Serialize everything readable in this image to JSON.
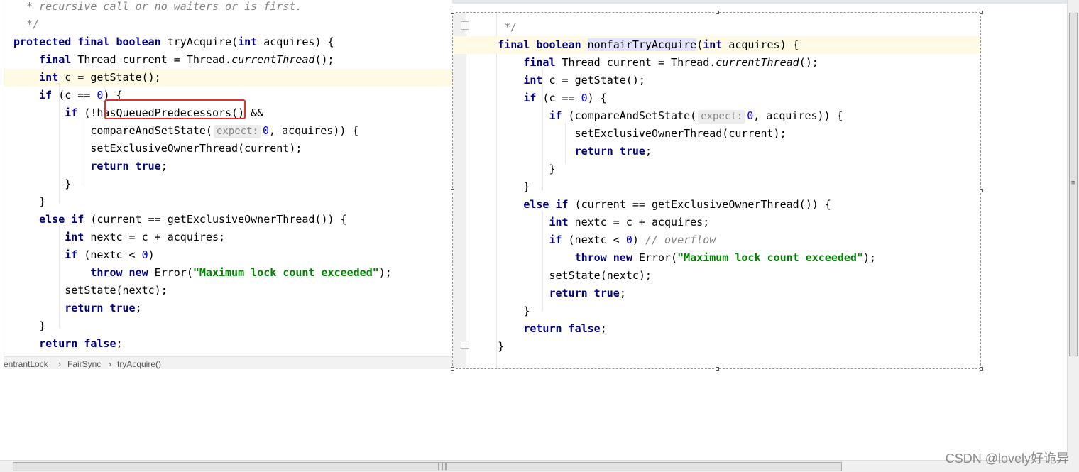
{
  "left_editor": {
    "lines": [
      [
        {
          "t": "  * recursive call or no waiters or is first.",
          "c": "cm"
        }
      ],
      [
        {
          "t": "  */",
          "c": "cm"
        }
      ],
      [
        {
          "t": "protected final boolean",
          "c": "kw"
        },
        {
          "t": " tryAcquire("
        },
        {
          "t": "int",
          "c": "kw"
        },
        {
          "t": " acquires) {"
        }
      ],
      [
        {
          "t": "    "
        },
        {
          "t": "final",
          "c": "kw"
        },
        {
          "t": " Thread current = Thread."
        },
        {
          "t": "currentThread",
          "c": "ita"
        },
        {
          "t": "();"
        }
      ],
      [
        {
          "t": "    "
        },
        {
          "t": "int",
          "c": "kw"
        },
        {
          "t": " c = getState();"
        }
      ],
      [
        {
          "t": "    "
        },
        {
          "t": "if",
          "c": "kw"
        },
        {
          "t": " (c == "
        },
        {
          "t": "0",
          "c": "num"
        },
        {
          "t": ") {"
        }
      ],
      [
        {
          "t": "        "
        },
        {
          "t": "if",
          "c": "kw"
        },
        {
          "t": " (!hasQueuedPredecessors() &&"
        }
      ],
      [
        {
          "t": "            compareAndSetState("
        },
        {
          "t": "expect:",
          "c": "hint"
        },
        {
          "t": "0",
          "c": "num"
        },
        {
          "t": ", acquires)) {"
        }
      ],
      [
        {
          "t": "            setExclusiveOwnerThread(current);"
        }
      ],
      [
        {
          "t": "            "
        },
        {
          "t": "return true",
          "c": "kw"
        },
        {
          "t": ";"
        }
      ],
      [
        {
          "t": "        }"
        }
      ],
      [
        {
          "t": "    }"
        }
      ],
      [
        {
          "t": "    "
        },
        {
          "t": "else if",
          "c": "kw"
        },
        {
          "t": " (current == getExclusiveOwnerThread()) {"
        }
      ],
      [
        {
          "t": "        "
        },
        {
          "t": "int",
          "c": "kw"
        },
        {
          "t": " nextc = c + acquires;"
        }
      ],
      [
        {
          "t": "        "
        },
        {
          "t": "if",
          "c": "kw"
        },
        {
          "t": " (nextc < "
        },
        {
          "t": "0",
          "c": "num"
        },
        {
          "t": ")"
        }
      ],
      [
        {
          "t": "            "
        },
        {
          "t": "throw new",
          "c": "kw"
        },
        {
          "t": " Error("
        },
        {
          "t": "\"Maximum lock count exceeded\"",
          "c": "str"
        },
        {
          "t": ");"
        }
      ],
      [
        {
          "t": "        setState(nextc);"
        }
      ],
      [
        {
          "t": "        "
        },
        {
          "t": "return true",
          "c": "kw"
        },
        {
          "t": ";"
        }
      ],
      [
        {
          "t": "    }"
        }
      ],
      [
        {
          "t": "    "
        },
        {
          "t": "return false",
          "c": "kw"
        },
        {
          "t": ";"
        }
      ]
    ],
    "highlighted_line": 4
  },
  "right_editor": {
    "lines": [
      [
        {
          "t": "        */",
          "c": "cm"
        }
      ],
      [
        {
          "t": "       "
        },
        {
          "t": "final boolean",
          "c": "kw"
        },
        {
          "t": " "
        },
        {
          "t": "nonfairTryAcquire",
          "c": "mark"
        },
        {
          "t": "("
        },
        {
          "t": "int",
          "c": "kw"
        },
        {
          "t": " acquires) {"
        }
      ],
      [
        {
          "t": "           "
        },
        {
          "t": "final",
          "c": "kw"
        },
        {
          "t": " Thread current = Thread."
        },
        {
          "t": "currentThread",
          "c": "ita"
        },
        {
          "t": "();"
        }
      ],
      [
        {
          "t": "           "
        },
        {
          "t": "int",
          "c": "kw"
        },
        {
          "t": " c = getState();"
        }
      ],
      [
        {
          "t": "           "
        },
        {
          "t": "if",
          "c": "kw"
        },
        {
          "t": " (c == "
        },
        {
          "t": "0",
          "c": "num"
        },
        {
          "t": ") {"
        }
      ],
      [
        {
          "t": "               "
        },
        {
          "t": "if",
          "c": "kw"
        },
        {
          "t": " (compareAndSetState("
        },
        {
          "t": "expect:",
          "c": "hint"
        },
        {
          "t": "0",
          "c": "num"
        },
        {
          "t": ", acquires)) {"
        }
      ],
      [
        {
          "t": "                   setExclusiveOwnerThread(current);"
        }
      ],
      [
        {
          "t": "                   "
        },
        {
          "t": "return true",
          "c": "kw"
        },
        {
          "t": ";"
        }
      ],
      [
        {
          "t": "               }"
        }
      ],
      [
        {
          "t": "           }"
        }
      ],
      [
        {
          "t": "           "
        },
        {
          "t": "else if",
          "c": "kw"
        },
        {
          "t": " (current == getExclusiveOwnerThread()) {"
        }
      ],
      [
        {
          "t": "               "
        },
        {
          "t": "int",
          "c": "kw"
        },
        {
          "t": " nextc = c + acquires;"
        }
      ],
      [
        {
          "t": "               "
        },
        {
          "t": "if",
          "c": "kw"
        },
        {
          "t": " (nextc < "
        },
        {
          "t": "0",
          "c": "num"
        },
        {
          "t": ") "
        },
        {
          "t": "// overflow",
          "c": "cm"
        }
      ],
      [
        {
          "t": "                   "
        },
        {
          "t": "throw new",
          "c": "kw"
        },
        {
          "t": " Error("
        },
        {
          "t": "\"Maximum lock count exceeded\"",
          "c": "str"
        },
        {
          "t": ");"
        }
      ],
      [
        {
          "t": "               setState(nextc);"
        }
      ],
      [
        {
          "t": "               "
        },
        {
          "t": "return true",
          "c": "kw"
        },
        {
          "t": ";"
        }
      ],
      [
        {
          "t": "           }"
        }
      ],
      [
        {
          "t": "           "
        },
        {
          "t": "return false",
          "c": "kw"
        },
        {
          "t": ";"
        }
      ],
      [
        {
          "t": "       }"
        }
      ]
    ],
    "highlighted_line": 1
  },
  "breadcrumb": {
    "items": [
      "entrantLock",
      "FairSync",
      "tryAcquire()"
    ],
    "separator": "›"
  },
  "scrollbar_grip": "|||",
  "watermark": "CSDN @lovely好诡异",
  "colors": {
    "keyword": "#000080",
    "number": "#0000ff",
    "string": "#008000",
    "comment": "#808080",
    "current_line": "#fffae3",
    "selection_mark": "#e3e3ff",
    "annotation_box": "#e03030"
  }
}
